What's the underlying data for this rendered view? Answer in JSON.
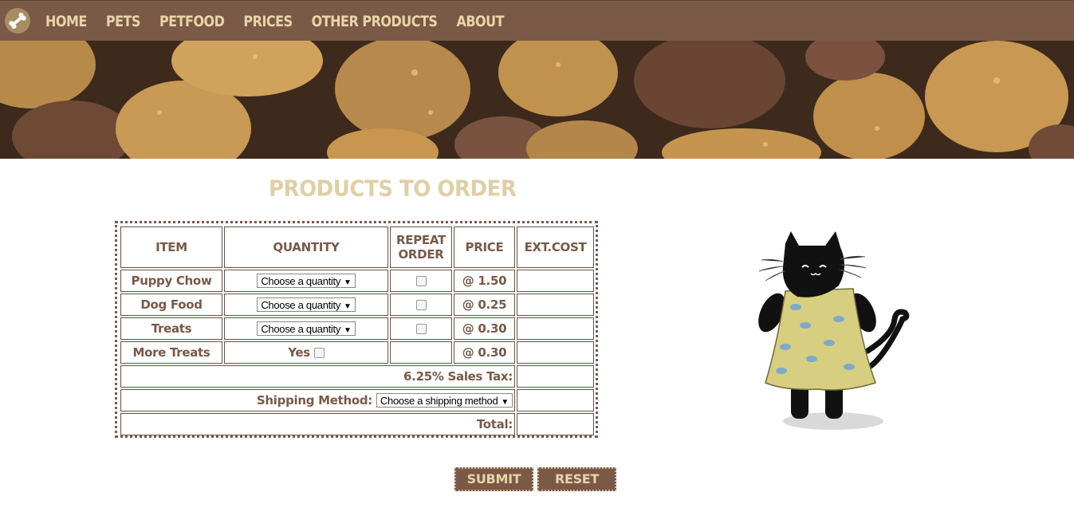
{
  "nav": {
    "logo_icon": "bone-icon",
    "items": [
      "HOME",
      "PETS",
      "PETFOOD",
      "PRICES",
      "OTHER PRODUCTS",
      "ABOUT"
    ]
  },
  "banner": {
    "description_icon": "kibble-banner"
  },
  "heading": "PRODUCTS TO ORDER",
  "table": {
    "headers": {
      "item": "ITEM",
      "quantity": "QUANTITY",
      "repeat_line1": "REPEAT",
      "repeat_line2": "ORDER",
      "price": "PRICE",
      "ext_cost": "EXT.COST"
    },
    "rows": [
      {
        "item": "Puppy Chow",
        "quantity": "Choose a quantity",
        "price": "@ 1.50"
      },
      {
        "item": "Dog Food",
        "quantity": "Choose a quantity",
        "price": "@ 0.25"
      },
      {
        "item": "Treats",
        "quantity": "Choose a quantity",
        "price": "@ 0.30"
      },
      {
        "item": "More Treats",
        "yes_label": "Yes",
        "price": "@ 0.30"
      }
    ],
    "sales_tax_label": "6.25% Sales Tax:",
    "shipping_label": "Shipping Method:",
    "shipping_select": "Choose a shipping method",
    "total_label": "Total:"
  },
  "buttons": {
    "submit": "SUBMIT",
    "reset": "RESET"
  },
  "colors": {
    "brand": "#7a5947",
    "accent": "#e0cfa6"
  }
}
